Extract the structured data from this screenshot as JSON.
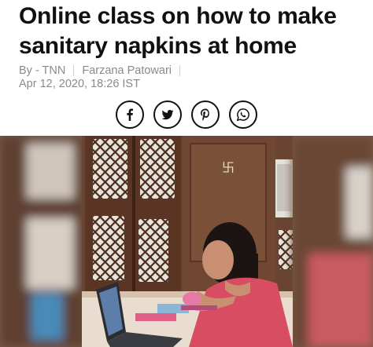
{
  "article": {
    "title": "Online class on how to make sanitary napkins at home",
    "byline": {
      "source": "By - TNN",
      "author": "Farzana Patowari"
    },
    "date": "Apr 12, 2020, 18:26 IST"
  },
  "share": {
    "buttons": [
      {
        "icon": "facebook-icon",
        "glyph": "f"
      },
      {
        "icon": "twitter-icon",
        "glyph": "bird"
      },
      {
        "icon": "pinterest-icon",
        "glyph": "p"
      },
      {
        "icon": "whatsapp-icon",
        "glyph": "phone"
      }
    ]
  },
  "colors": {
    "headline": "#111111",
    "meta": "#8a8a8a",
    "icon_stroke": "#111111"
  }
}
